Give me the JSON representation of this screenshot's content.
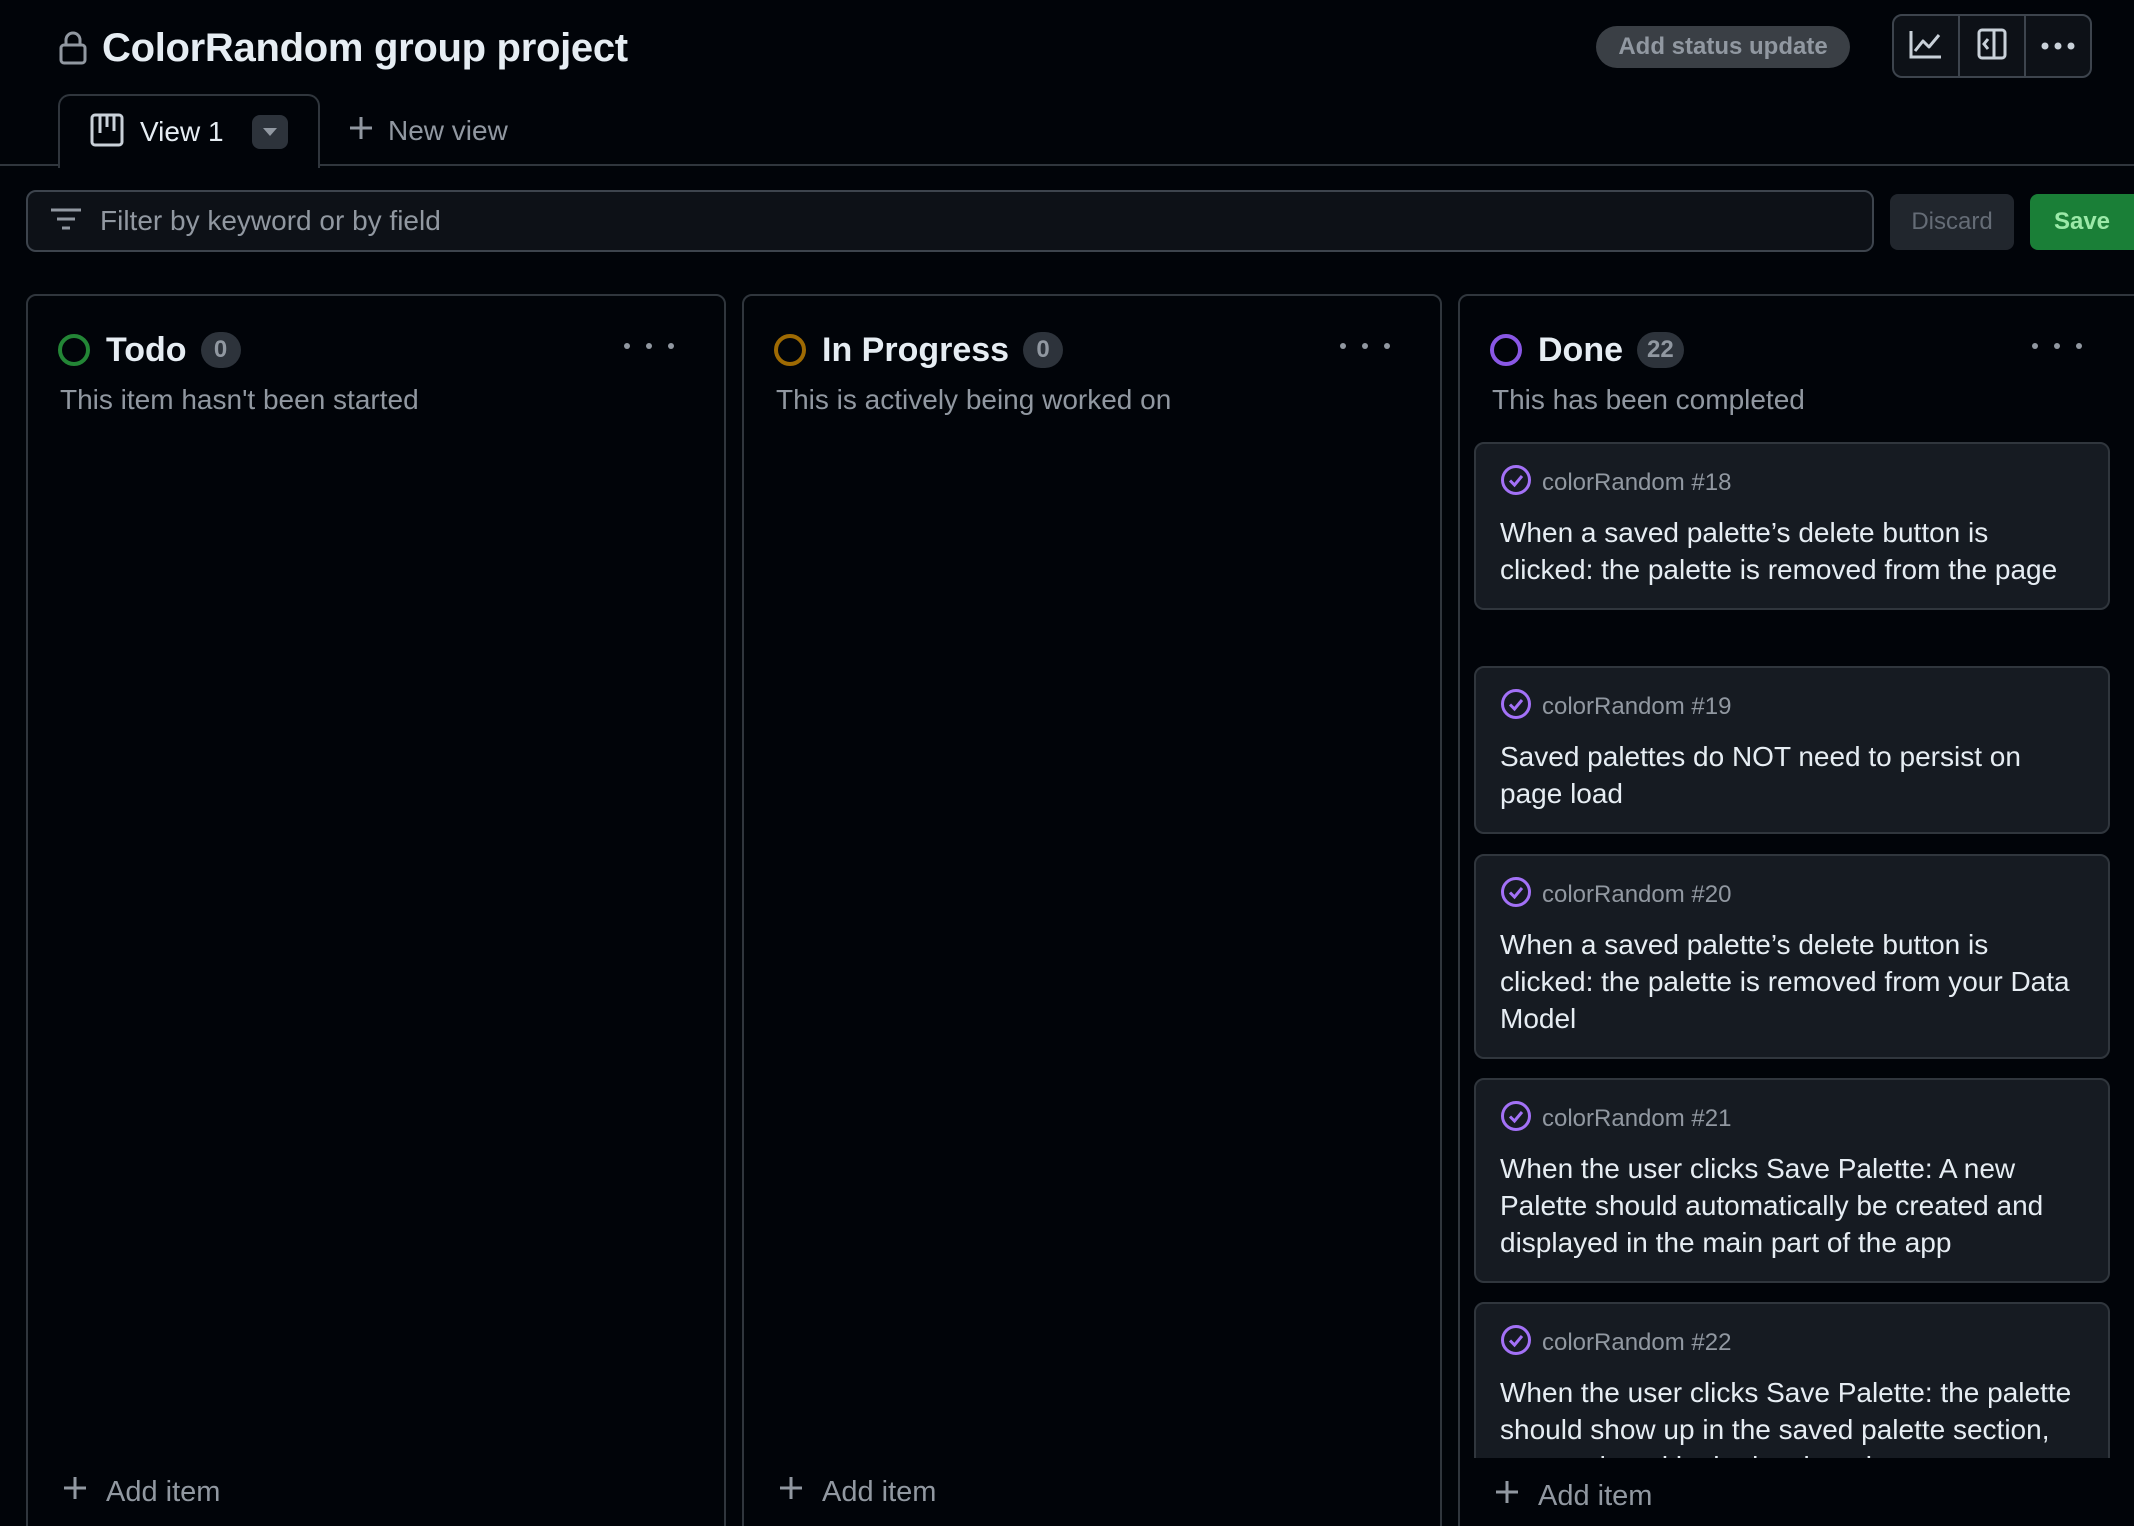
{
  "project": {
    "title": "ColorRandom group project",
    "status_update_label": "Add status update",
    "toolbar_icons": [
      "insights-graph-icon",
      "side-panel-icon",
      "more-options-icon"
    ]
  },
  "tabs": {
    "active": {
      "label": "View 1"
    },
    "new_view_label": "New view"
  },
  "filter": {
    "placeholder": "Filter by keyword or by field",
    "discard_label": "Discard",
    "save_label": "Save"
  },
  "colors": {
    "todo": "#238636",
    "in_progress": "#9e6a03",
    "done": "#8957e5",
    "save": "#1a7f37"
  },
  "columns": [
    {
      "name": "Todo",
      "count": "0",
      "description": "This item hasn't been started",
      "add_item_label": "Add item",
      "cards": []
    },
    {
      "name": "In Progress",
      "count": "0",
      "description": "This is actively being worked on",
      "add_item_label": "Add item",
      "cards": []
    },
    {
      "name": "Done",
      "count": "22",
      "description": "This has been completed",
      "add_item_label": "Add item",
      "cards": [
        {
          "ref": "colorRandom #18",
          "title": "When a saved palette’s delete button is clicked: the palette is removed from the page"
        },
        {
          "ref": "colorRandom #19",
          "title": "Saved palettes do NOT need to persist on page load"
        },
        {
          "ref": "colorRandom #20",
          "title": "When a saved palette’s delete button is clicked: the palette is removed from your Data Model"
        },
        {
          "ref": "colorRandom #21",
          "title": "When the user clicks Save Palette: A new Palette should automatically be created and displayed in the main part of the app"
        },
        {
          "ref": "colorRandom #22",
          "title": "When the user clicks Save Palette: the palette should show up in the saved palette section, as mentioned in the last iteration"
        }
      ]
    }
  ]
}
